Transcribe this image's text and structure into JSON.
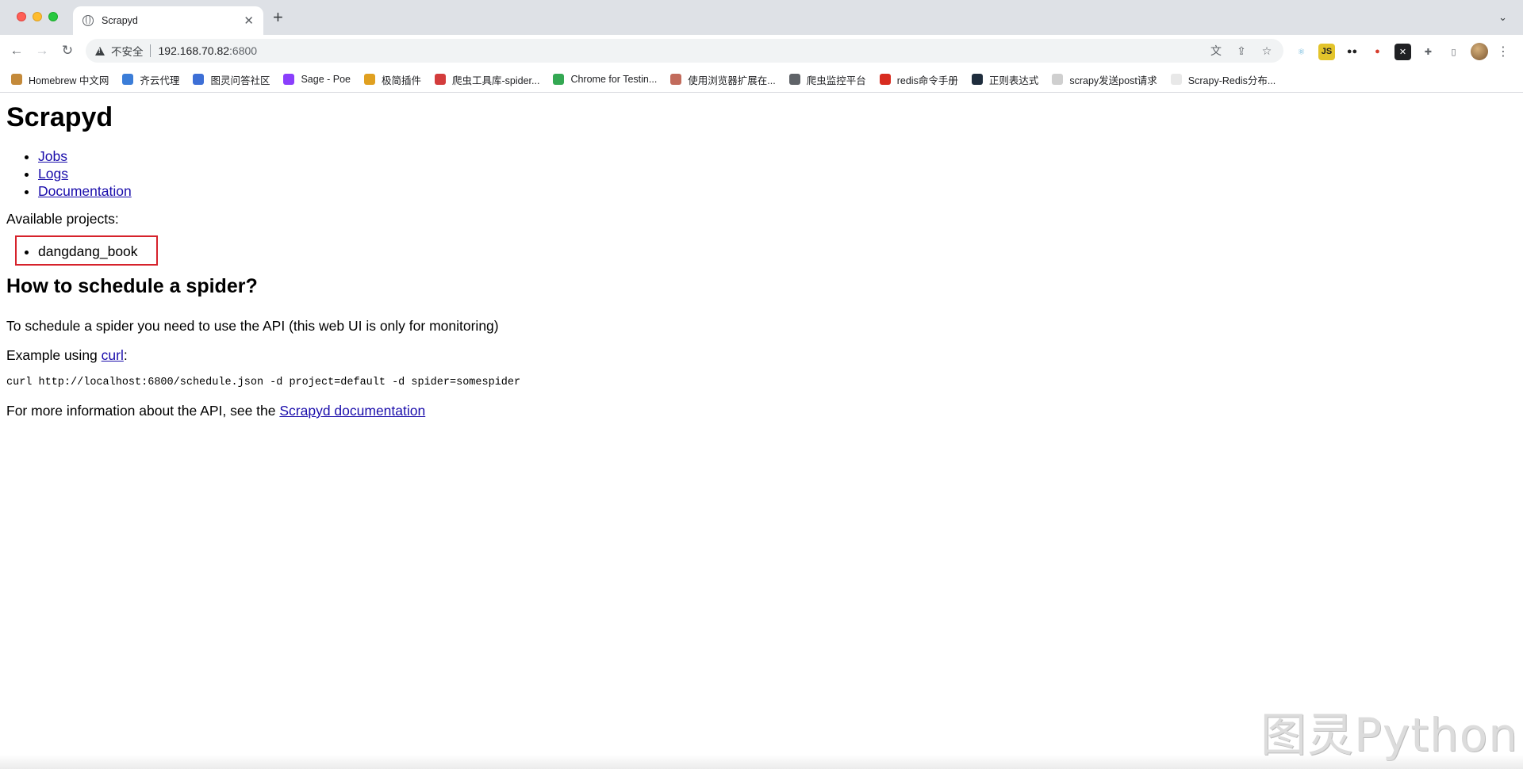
{
  "browser": {
    "tab_title": "Scrapyd",
    "address": {
      "security_label": "不安全",
      "host": "192.168.70.82",
      "port": ":6800"
    },
    "omnibox_icons": [
      "translate-icon",
      "share-icon",
      "star-icon"
    ],
    "extensions": [
      "react-icon",
      "js-icon",
      "glasses-icon",
      "tomato-icon",
      "x-icon",
      "puzzle-icon",
      "sidepanel-icon"
    ],
    "bookmarks": [
      {
        "label": "Homebrew 中文网",
        "color": "#c48a3a"
      },
      {
        "label": "齐云代理",
        "color": "#3b7dd8"
      },
      {
        "label": "图灵问答社区",
        "color": "#3d6fd6"
      },
      {
        "label": "Sage - Poe",
        "color": "#8a3ffc"
      },
      {
        "label": "极简插件",
        "color": "#e0a020"
      },
      {
        "label": "爬虫工具库-spider...",
        "color": "#d33c3c"
      },
      {
        "label": "Chrome for Testin...",
        "color": "#34a853"
      },
      {
        "label": "使用浏览器扩展在...",
        "color": "#c26b5c"
      },
      {
        "label": "爬虫监控平台",
        "color": "#5f6368"
      },
      {
        "label": "redis命令手册",
        "color": "#d82c20"
      },
      {
        "label": "正则表达式",
        "color": "#1f2d3d"
      },
      {
        "label": "scrapy发送post请求",
        "color": "#cfcfcf"
      },
      {
        "label": "Scrapy-Redis分布...",
        "color": "#e8e8e8"
      }
    ]
  },
  "page": {
    "title": "Scrapyd",
    "nav_links": [
      "Jobs",
      "Logs",
      "Documentation"
    ],
    "available_label": "Available projects:",
    "projects": [
      "dangdang_book"
    ],
    "howto_heading": "How to schedule a spider?",
    "intro": "To schedule a spider you need to use the API (this web UI is only for monitoring)",
    "example_prefix": "Example using ",
    "example_link": "curl",
    "example_suffix": ":",
    "code": "curl http://localhost:6800/schedule.json -d project=default -d spider=somespider",
    "more_prefix": "For more information about the API, see the ",
    "more_link": "Scrapyd documentation"
  },
  "watermark": "图灵Python",
  "colors": {
    "highlight_box": "#d6222b",
    "link": "#1a0dab"
  }
}
